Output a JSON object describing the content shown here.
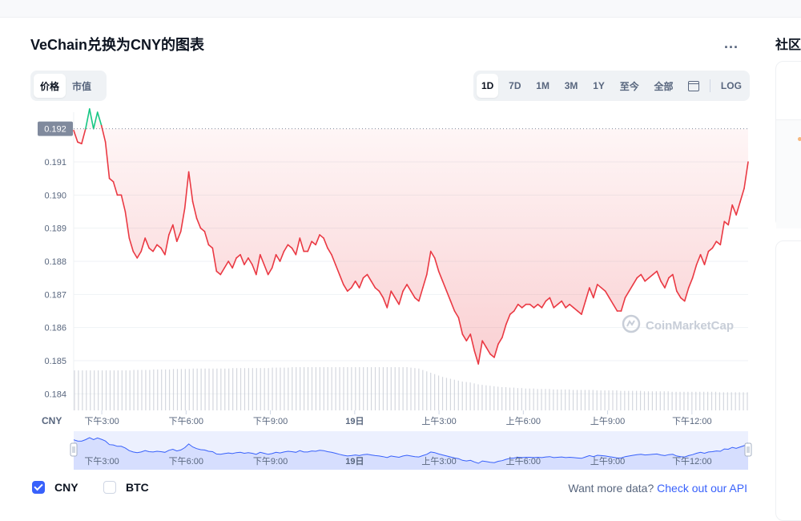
{
  "page": {
    "title": "VeChain兑换为CNY的图表",
    "more_label": "...",
    "side_title": "社区"
  },
  "type_tabs": [
    {
      "label": "价格",
      "active": true
    },
    {
      "label": "市值",
      "active": false
    }
  ],
  "range_tabs": [
    {
      "label": "1D",
      "active": true
    },
    {
      "label": "7D",
      "active": false
    },
    {
      "label": "1M",
      "active": false
    },
    {
      "label": "3M",
      "active": false
    },
    {
      "label": "1Y",
      "active": false
    },
    {
      "label": "至今",
      "active": false
    },
    {
      "label": "全部",
      "active": false
    }
  ],
  "calendar_icon": "calendar-icon",
  "log_label": "LOG",
  "chart_data": {
    "type": "area",
    "currency_label": "CNY",
    "watermark": "CoinMarketCap",
    "reference_price_label": "0.192",
    "reference_price": 0.192,
    "ylim": [
      0.1835,
      0.1925
    ],
    "yticks": [
      "0.191",
      "0.190",
      "0.189",
      "0.188",
      "0.187",
      "0.186",
      "0.185",
      "0.184"
    ],
    "xticks": [
      "下午3:00",
      "下午6:00",
      "下午9:00",
      "19日",
      "上午3:00",
      "上午6:00",
      "上午9:00",
      "下午12:00"
    ],
    "x_hours": [
      0,
      24
    ],
    "xtick_hours": [
      1,
      4,
      7,
      10,
      13,
      16,
      19,
      22
    ],
    "colors": {
      "up": "#16c784",
      "down": "#ea3943",
      "grid": "#eff2f5",
      "volume": "#c5cad3",
      "navigator": "#3861fb"
    },
    "series": [
      {
        "values": [
          0.19195,
          0.1916,
          0.19155,
          0.192,
          0.1926,
          0.192,
          0.1925,
          0.1921,
          0.1916,
          0.1905,
          0.1904,
          0.19,
          0.19,
          0.1895,
          0.1887,
          0.1883,
          0.1881,
          0.1883,
          0.1887,
          0.1884,
          0.1883,
          0.1885,
          0.1884,
          0.1882,
          0.1888,
          0.1891,
          0.1886,
          0.1889,
          0.1896,
          0.1907,
          0.1898,
          0.1893,
          0.189,
          0.1889,
          0.1885,
          0.1884,
          0.1877,
          0.1876,
          0.1878,
          0.188,
          0.1878,
          0.1881,
          0.1882,
          0.1879,
          0.1881,
          0.1879,
          0.1876,
          0.1882,
          0.1879,
          0.1876,
          0.1878,
          0.1882,
          0.188,
          0.1883,
          0.1885,
          0.1884,
          0.1882,
          0.1887,
          0.1883,
          0.1883,
          0.1886,
          0.1885,
          0.1888,
          0.1887,
          0.1884,
          0.1882,
          0.1879,
          0.1876,
          0.1873,
          0.1871,
          0.1872,
          0.1874,
          0.1872,
          0.1875,
          0.1876,
          0.1874,
          0.1872,
          0.1871,
          0.1869,
          0.1866,
          0.1871,
          0.1869,
          0.1867,
          0.1871,
          0.1873,
          0.1871,
          0.1869,
          0.1868,
          0.1872,
          0.1876,
          0.1883,
          0.1881,
          0.1877,
          0.1874,
          0.1871,
          0.1868,
          0.1865,
          0.1863,
          0.1858,
          0.1856,
          0.1858,
          0.1853,
          0.1849,
          0.1856,
          0.1854,
          0.1852,
          0.1851,
          0.1855,
          0.1857,
          0.1861,
          0.1864,
          0.1865,
          0.1867,
          0.1866,
          0.1867,
          0.1867,
          0.1866,
          0.1867,
          0.1866,
          0.1868,
          0.1869,
          0.1866,
          0.1867,
          0.1868,
          0.1866,
          0.1867,
          0.1866,
          0.1865,
          0.1864,
          0.1868,
          0.1872,
          0.1869,
          0.1873,
          0.1872,
          0.1871,
          0.1869,
          0.1867,
          0.1865,
          0.1865,
          0.1869,
          0.1871,
          0.1873,
          0.1875,
          0.1876,
          0.1874,
          0.1875,
          0.1876,
          0.1877,
          0.1874,
          0.1872,
          0.1875,
          0.1876,
          0.1871,
          0.1869,
          0.1868,
          0.1872,
          0.1875,
          0.1879,
          0.1882,
          0.1879,
          0.1883,
          0.1884,
          0.1886,
          0.1885,
          0.1892,
          0.1891,
          0.1897,
          0.1894,
          0.1898,
          0.1902,
          0.191
        ]
      }
    ],
    "volume": [
      0.86,
      0.86,
      0.86,
      0.86,
      0.86,
      0.86,
      0.86,
      0.86,
      0.86,
      0.86,
      0.86,
      0.86,
      0.86,
      0.86,
      0.86,
      0.87,
      0.87,
      0.87,
      0.87,
      0.87,
      0.88,
      0.88,
      0.88,
      0.88,
      0.88,
      0.89,
      0.89,
      0.89,
      0.89,
      0.89,
      0.9,
      0.9,
      0.9,
      0.9,
      0.9,
      0.9,
      0.9,
      0.9,
      0.9,
      0.9,
      0.91,
      0.91,
      0.91,
      0.91,
      0.91,
      0.91,
      0.91,
      0.91,
      0.91,
      0.91,
      0.92,
      0.92,
      0.92,
      0.92,
      0.92,
      0.93,
      0.93,
      0.93,
      0.93,
      0.93,
      0.93,
      0.93,
      0.93,
      0.93,
      0.93,
      0.93,
      0.93,
      0.93,
      0.93,
      0.93,
      0.93,
      0.93,
      0.93,
      0.93,
      0.93,
      0.93,
      0.93,
      0.93,
      0.93,
      0.93,
      0.93,
      0.93,
      0.93,
      0.93,
      0.93,
      0.92,
      0.91,
      0.9,
      0.87,
      0.84,
      0.81,
      0.78,
      0.75,
      0.72,
      0.7,
      0.68,
      0.66,
      0.64,
      0.62,
      0.61,
      0.6,
      0.58,
      0.56,
      0.55,
      0.54,
      0.53,
      0.52,
      0.51,
      0.5,
      0.5,
      0.49,
      0.49,
      0.48,
      0.48,
      0.47,
      0.47,
      0.47,
      0.46,
      0.46,
      0.46,
      0.46,
      0.45,
      0.45,
      0.45,
      0.45,
      0.45,
      0.44,
      0.44,
      0.44,
      0.44,
      0.44,
      0.44,
      0.43,
      0.43,
      0.43,
      0.43,
      0.43,
      0.43,
      0.42,
      0.42,
      0.42,
      0.42,
      0.42,
      0.42,
      0.41,
      0.41,
      0.41,
      0.41,
      0.41,
      0.41,
      0.41,
      0.4,
      0.4,
      0.4,
      0.4,
      0.4,
      0.4,
      0.4,
      0.4,
      0.4,
      0.4,
      0.4,
      0.4,
      0.39,
      0.39,
      0.39,
      0.39,
      0.39,
      0.39,
      0.39,
      0.39
    ]
  },
  "legend": [
    {
      "label": "CNY",
      "checked": true
    },
    {
      "label": "BTC",
      "checked": false
    }
  ],
  "api_note": {
    "text": "Want more data?",
    "link": "Check out our API"
  }
}
